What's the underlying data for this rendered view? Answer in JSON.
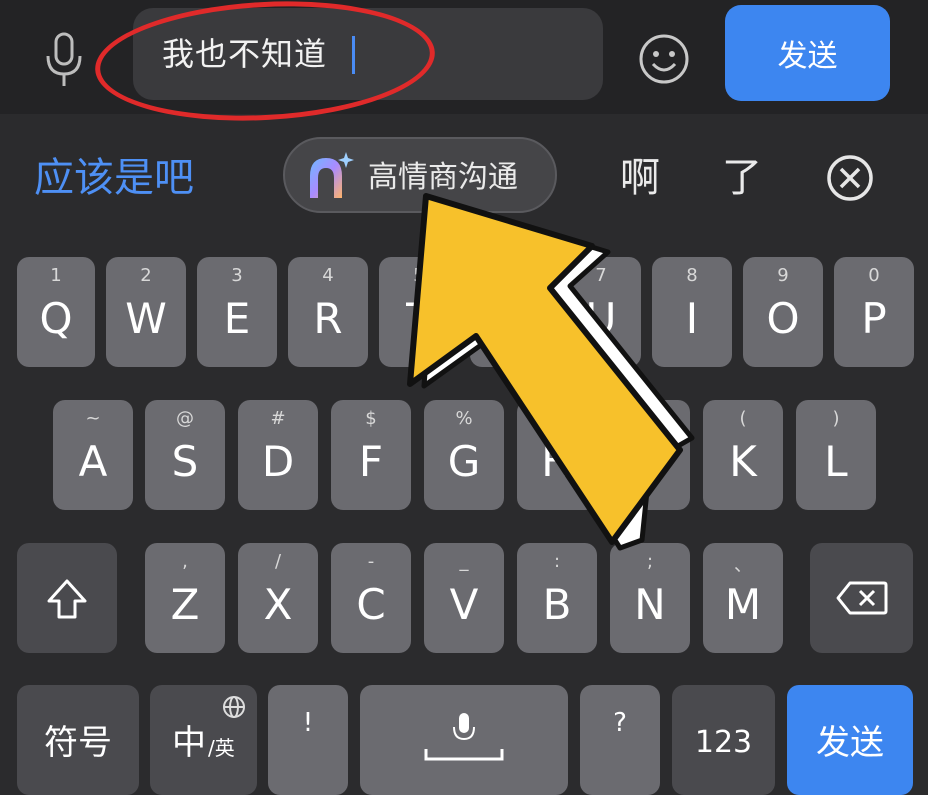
{
  "input": {
    "text": "我也不知道"
  },
  "top_send_label": "发送",
  "candidates": {
    "first": "应该是吧",
    "ai_label": "高情商沟通",
    "c3": "啊",
    "c4": "了"
  },
  "rows": {
    "row1": [
      {
        "sub": "1",
        "main": "Q"
      },
      {
        "sub": "2",
        "main": "W"
      },
      {
        "sub": "3",
        "main": "E"
      },
      {
        "sub": "4",
        "main": "R"
      },
      {
        "sub": "5",
        "main": "T"
      },
      {
        "sub": "",
        "main": ""
      },
      {
        "sub": "7",
        "main": "U"
      },
      {
        "sub": "8",
        "main": "I"
      },
      {
        "sub": "9",
        "main": "O"
      },
      {
        "sub": "0",
        "main": "P"
      }
    ],
    "row2": [
      {
        "sub": "~",
        "main": "A"
      },
      {
        "sub": "@",
        "main": "S"
      },
      {
        "sub": "#",
        "main": "D"
      },
      {
        "sub": "$",
        "main": "F"
      },
      {
        "sub": "%",
        "main": "G"
      },
      {
        "sub": "",
        "main": "H"
      },
      {
        "sub": "",
        "main": ""
      },
      {
        "sub": "(",
        "main": "K"
      },
      {
        "sub": ")",
        "main": "L"
      }
    ],
    "row3": [
      {
        "sub": ",",
        "main": "Z"
      },
      {
        "sub": "/",
        "main": "X"
      },
      {
        "sub": "-",
        "main": "C"
      },
      {
        "sub": "_",
        "main": "V"
      },
      {
        "sub": ":",
        "main": "B"
      },
      {
        "sub": ";",
        "main": "N"
      },
      {
        "sub": "、",
        "main": "M"
      }
    ]
  },
  "bottom": {
    "symbols": "符号",
    "lang_main": "中",
    "lang_sub": "/英",
    "exclam": "!",
    "question": "?",
    "num": "123",
    "send": "发送"
  },
  "colors": {
    "accent": "#3d86f0",
    "annotation_red": "#e02a2a",
    "arrow_yellow": "#f7c12b"
  }
}
